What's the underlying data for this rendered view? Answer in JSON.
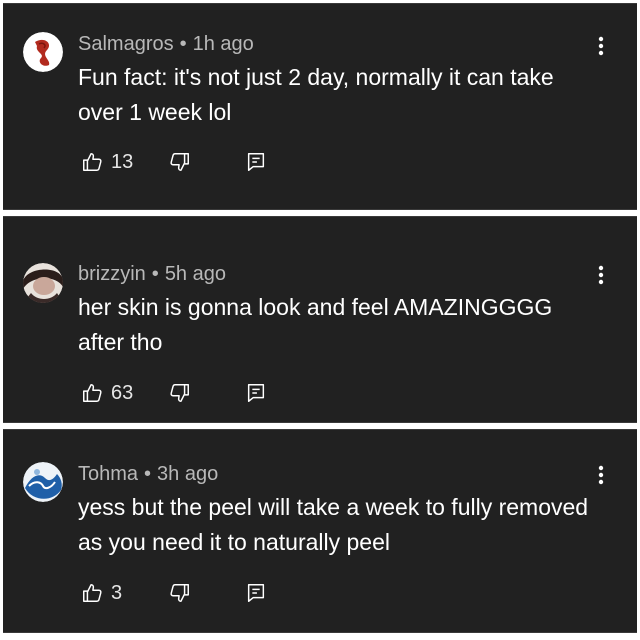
{
  "comments": [
    {
      "author": "Salmagros",
      "separator": "•",
      "time": "1h ago",
      "text": "Fun fact: it's not just 2 day, normally it can take over 1 week lol",
      "likes": "13",
      "avatar_color": "#c0392b"
    },
    {
      "author": "brizzyin",
      "separator": "•",
      "time": "5h ago",
      "text": "her skin is gonna look and feel AMAZINGGGG after tho",
      "likes": "63",
      "avatar_color": "#6b5048"
    },
    {
      "author": "Tohma",
      "separator": "•",
      "time": "3h ago",
      "text": "yess but the peel will take a week to fully removed as you need it to naturally peel",
      "likes": "3",
      "avatar_color": "#2b6cb0"
    }
  ],
  "icons": {
    "like": "thumb-up-icon",
    "dislike": "thumb-down-icon",
    "reply": "reply-icon",
    "menu": "more-vertical-icon"
  }
}
